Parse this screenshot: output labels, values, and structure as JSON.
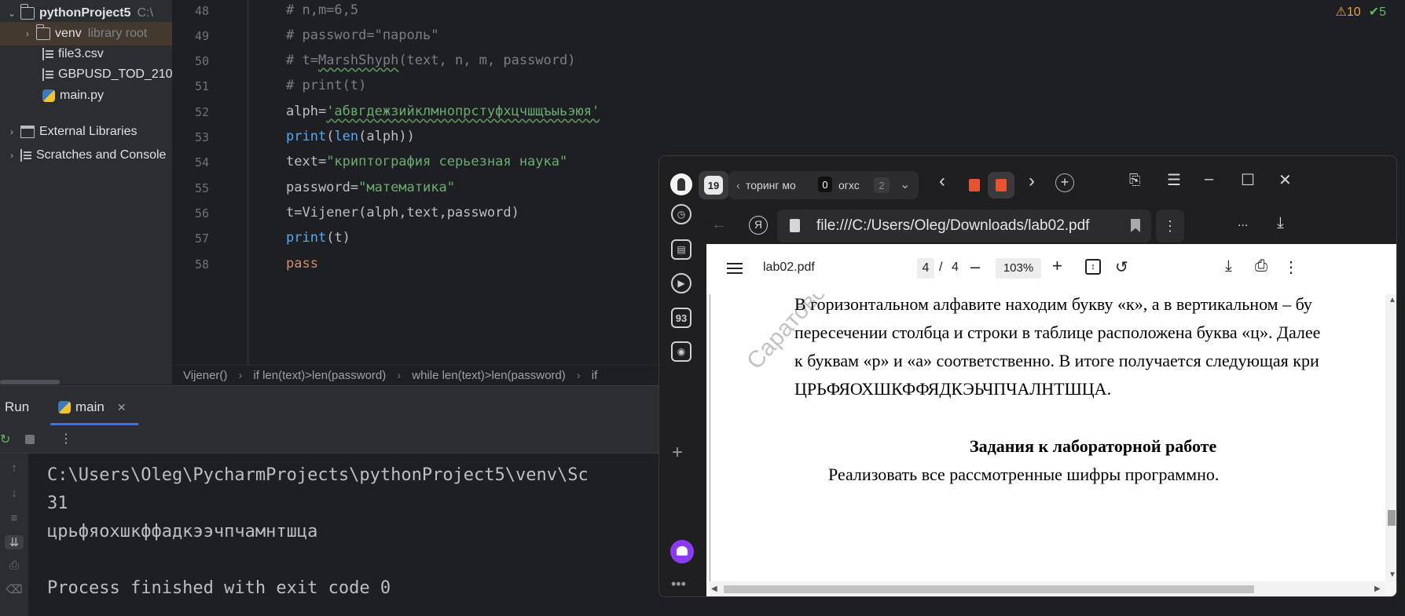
{
  "ide": {
    "project": {
      "root_name": "pythonProject5",
      "root_path": "C:\\",
      "venv_name": "venv",
      "venv_note": "library root",
      "files": [
        "file3.csv",
        "GBPUSD_TOD_210",
        "main.py"
      ],
      "external": "External Libraries",
      "scratches": "Scratches and Console"
    },
    "editor": {
      "lines": [
        48,
        49,
        50,
        51,
        52,
        53,
        54,
        55,
        56,
        57,
        58
      ],
      "code": {
        "l48": "# n,m=6,5",
        "l49": "# password=\"пароль\"",
        "l50a": "# t=",
        "l50b": "MarshShyph",
        "l50c": "(text, n, m, password)",
        "l51": "# print(t)",
        "l52a": "alph=",
        "l52b": "'абвгдежзийклмнопрстуфхцчшщъыьэюя'",
        "l53a": "print",
        "l53b": "(",
        "l53c": "len",
        "l53d": "(alph))",
        "l54a": "text=",
        "l54b": "\"криптография серьезная наука\"",
        "l55a": "password=",
        "l55b": "\"математика\"",
        "l56": "t=Vijener(alph,text,password)",
        "l57a": "print",
        "l57b": "(t)",
        "l58": "pass"
      },
      "warnings": "⚠10",
      "checks": "✔5"
    },
    "breadcrumb": [
      "Vijener()",
      "if len(text)>len(password)",
      "while len(text)>len(password)",
      "if"
    ],
    "run": {
      "title": "Run",
      "tab": "main",
      "console": [
        "C:\\Users\\Oleg\\PycharmProjects\\pythonProject5\\venv\\Sc",
        "31",
        "црьфяохшкффадкээчпчамнтшца",
        "",
        "Process finished with exit code 0"
      ]
    }
  },
  "browser": {
    "tab_count": "19",
    "tab1": "торинг мо",
    "tab2_badge": "0",
    "tab2": "огхс",
    "tab3": "2",
    "url": "file:///C:/Users/Oleg/Downloads/lab02.pdf",
    "more": "...",
    "side_counter": "93",
    "pdf": {
      "filename": "lab02.pdf",
      "page_current": "4",
      "page_sep": "/",
      "page_total": "4",
      "zoom": "103%",
      "watermark": "Саратовский гос",
      "lines": [
        "В горизонтальном алфавите находим букву «к», а в вертикальном – бу",
        "пересечении столбца и строки в таблице расположена буква «ц». Далее",
        "к буквам «р» и «а» соответственно. В итоге получается следующая кри",
        "ЦРЬФЯОХШКФФЯДКЭЬЧПЧАЛНТШЦА."
      ],
      "heading": "Задания к лабораторной работе",
      "task": "Реализовать все рассмотренные шифры программно."
    }
  }
}
